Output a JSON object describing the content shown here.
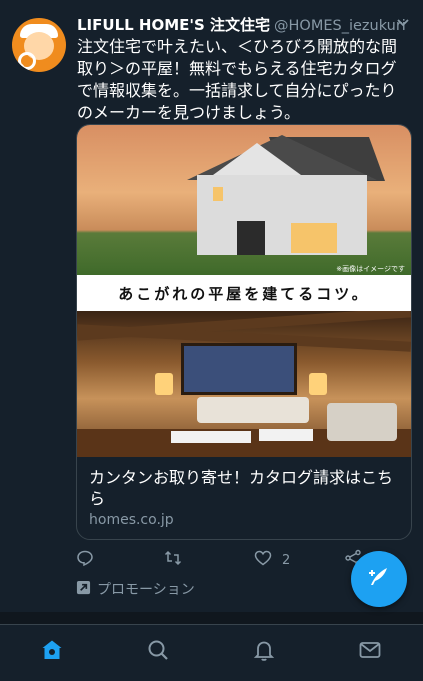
{
  "tweet": {
    "author_name": "LIFULL HOME'S 注文住宅",
    "author_handle": "@HOMES_iezukuri",
    "text": "注文住宅で叶えたい、＜ひろびろ開放的な間取り＞の平屋！無料でもらえる住宅カタログで情報収集を。一括請求して自分にぴったりのメーカーを見つけましょう。"
  },
  "card": {
    "image_caption": "※画像はイメージです",
    "banner_text": "あこがれの平屋を建てるコツ。",
    "title": "カンタンお取り寄せ！カタログ請求はこちら",
    "domain": "homes.co.jp"
  },
  "actions": {
    "like_count": "2"
  },
  "promotion_label": "プロモーション",
  "colors": {
    "background": "#15202b",
    "accent": "#1da1f2",
    "secondary_text": "#8899a6",
    "border": "#38444d"
  },
  "icons": {
    "reply": "reply-icon",
    "retweet": "retweet-icon",
    "like": "heart-icon",
    "share": "share-icon",
    "promoted": "promoted-arrow-icon",
    "compose": "compose-feather-icon",
    "home": "home-icon",
    "search": "search-icon",
    "notifications": "bell-icon",
    "messages": "mail-icon"
  }
}
